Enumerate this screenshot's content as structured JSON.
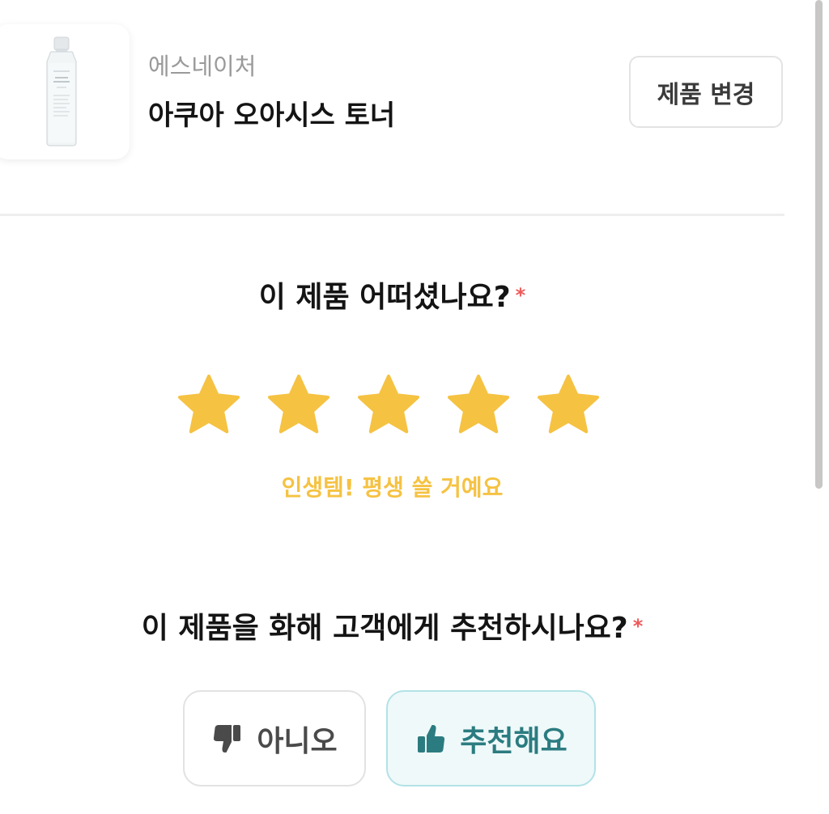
{
  "product": {
    "brand": "에스네이처",
    "name": "아쿠아 오아시스 토너",
    "bottle_label": "S.NATURE\nAQUA\nOASIS TONER",
    "change_button": "제품 변경"
  },
  "rating": {
    "question": "이 제품 어떠셨나요?",
    "required_mark": "*",
    "value": 5,
    "max": 5,
    "caption": "인생템! 평생 쓸 거예요",
    "star_color": "#f5c242"
  },
  "recommend": {
    "question": "이 제품을 화해 고객에게 추천하시나요?",
    "required_mark": "*",
    "no_label": "아니오",
    "yes_label": "추천해요",
    "selected": "yes"
  },
  "colors": {
    "required": "#ef5a5a",
    "accent_teal": "#2b7c80",
    "star": "#f5c242"
  },
  "icons": {
    "no": "thumbs-down-icon",
    "yes": "thumbs-up-icon"
  }
}
